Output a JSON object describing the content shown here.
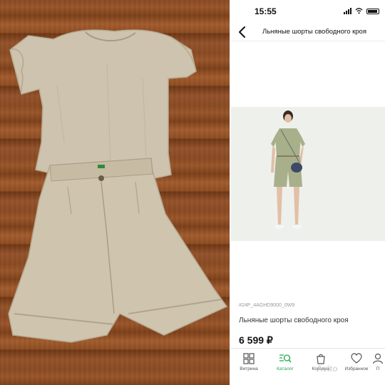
{
  "statusbar": {
    "time": "15:55"
  },
  "header": {
    "title": "Льняные шорты свободного кроя"
  },
  "product": {
    "sku": "#24P_4AGHD9000_0W9",
    "name": "Льняные шорты свободного кроя",
    "price": "6 599 ₽"
  },
  "tabbar": {
    "items": [
      {
        "label": "Витрина",
        "icon": "showcase-icon"
      },
      {
        "label": "Каталог",
        "icon": "catalog-search-icon"
      },
      {
        "label": "Корзина",
        "icon": "cart-bag-icon"
      },
      {
        "label": "Избранное",
        "icon": "heart-icon"
      },
      {
        "label": "П",
        "icon": "profile-icon"
      }
    ],
    "active": "Каталог"
  },
  "watermark": {
    "text": "Avito"
  },
  "colors": {
    "accent": "#1ea84a",
    "linen": "#cbbfa8",
    "wood": "#8a4a22",
    "dress": "#a7b08a"
  }
}
